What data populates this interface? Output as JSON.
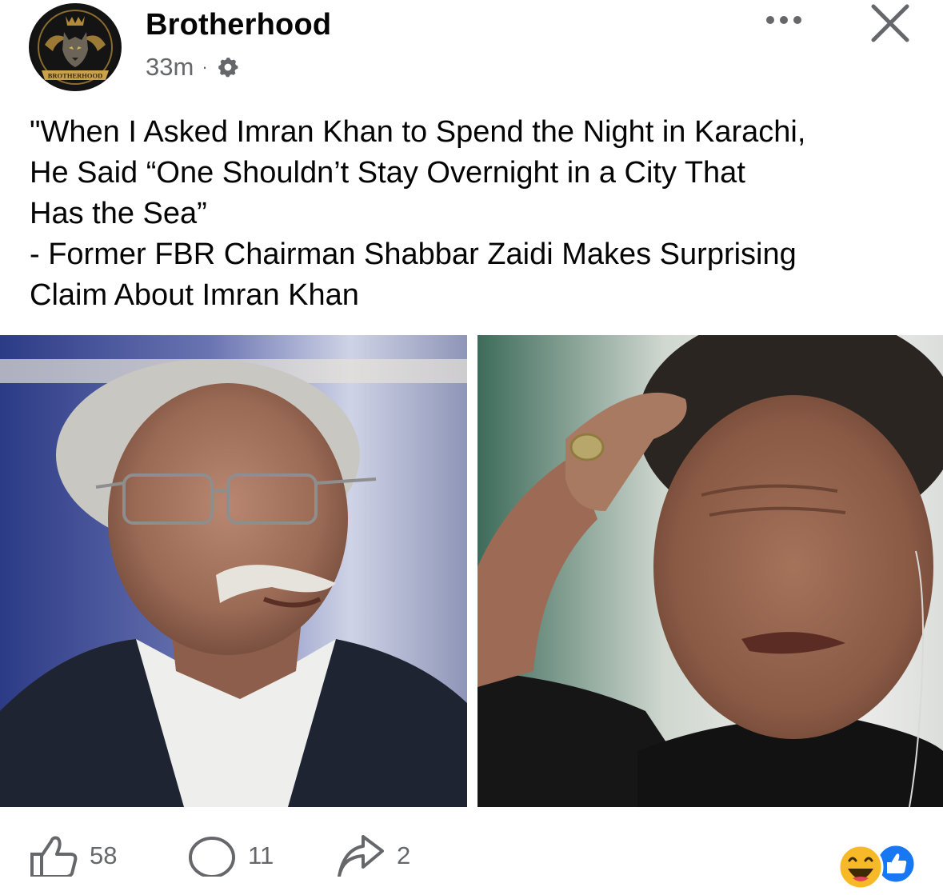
{
  "post": {
    "author": "Brotherhood",
    "avatar_logo_text": "BROTHERHOOD",
    "timestamp": "33m",
    "separator": "·",
    "privacy_icon": "gear-icon",
    "text": "\"When I Asked Imran Khan to Spend the Night in Karachi,\nHe Said “One Shouldn’t Stay Overnight in a City That\nHas the Sea”\n- Former FBR Chairman Shabbar Zaidi Makes Surprising\nClaim About Imran Khan",
    "photos": [
      {
        "name": "photo-left",
        "description_icon": "portrait-photo"
      },
      {
        "name": "photo-right",
        "description_icon": "portrait-photo"
      }
    ]
  },
  "header_actions": {
    "more_icon": "more-horizontal-icon",
    "close_icon": "close-icon"
  },
  "actions": {
    "likes": "58",
    "comments": "11",
    "shares": "2",
    "reactions": [
      "haha-emoji-icon",
      "like-reaction-icon"
    ]
  },
  "colors": {
    "text_primary": "#050505",
    "text_secondary": "#65676b",
    "like_blue": "#1877f2",
    "haha_yellow": "#f7b928"
  }
}
